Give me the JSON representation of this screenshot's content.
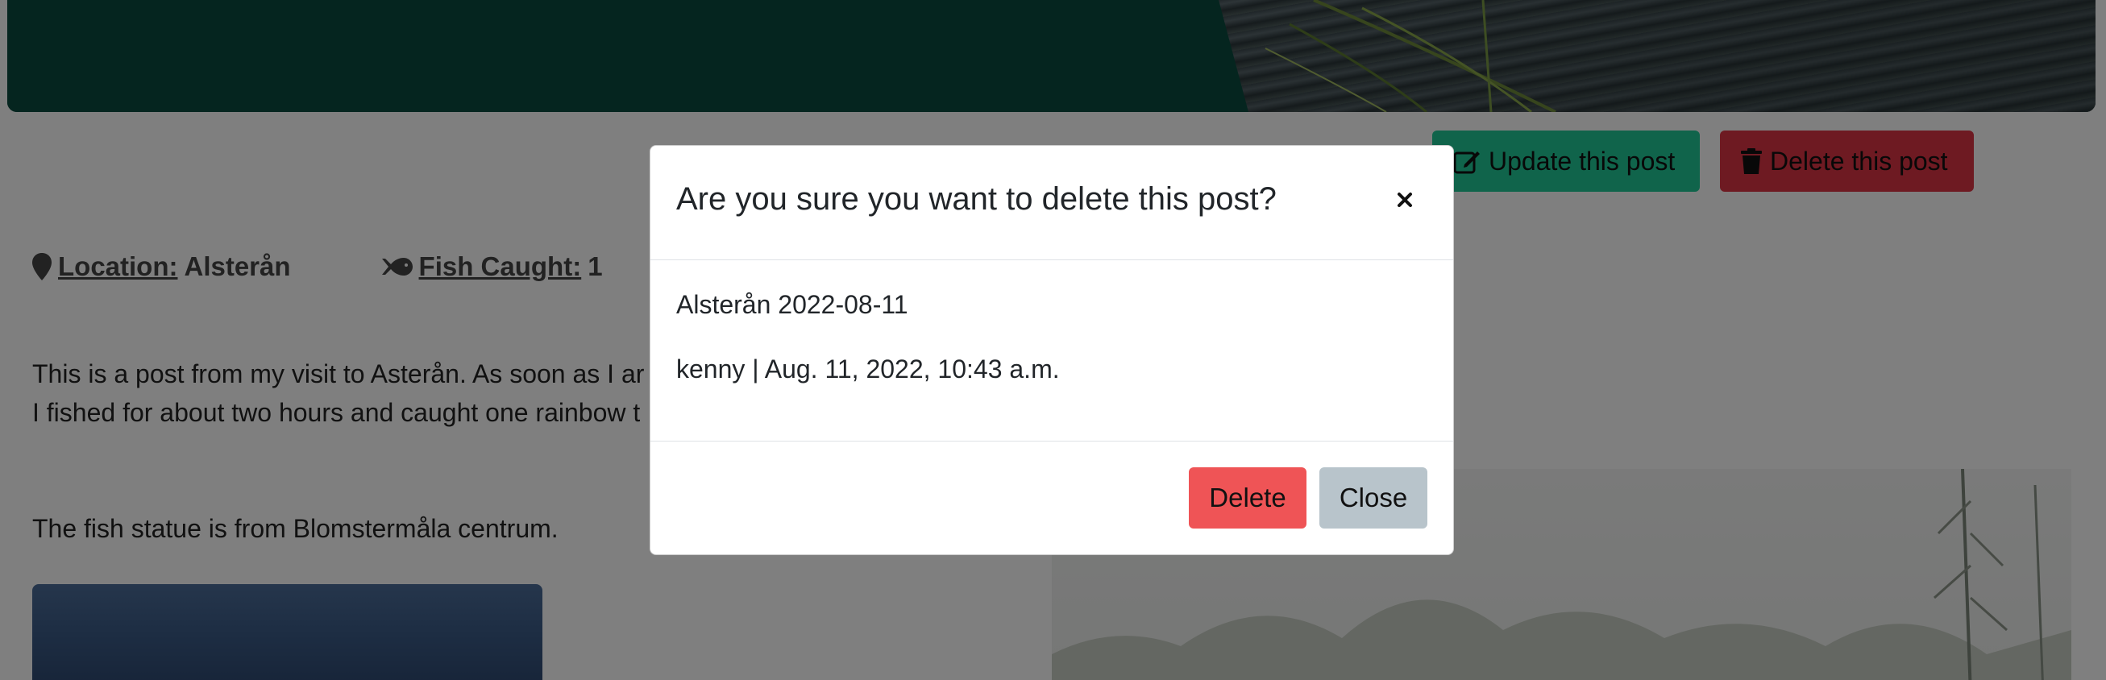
{
  "post": {
    "update_label": "Update this post",
    "delete_label": "Delete this post",
    "location_key": "Location:",
    "location_value": "Alsterån",
    "fish_key": "Fish Caught:",
    "fish_value": "1",
    "body_line1": "This is a post from my visit to Asterån. As soon as I ar",
    "body_line2": "I fished for about two hours and caught one rainbow t",
    "body_line3": "The fish statue is from Blomstermåla centrum."
  },
  "modal": {
    "title": "Are you sure you want to delete this post?",
    "post_title": "Alsterån 2022-08-11",
    "post_meta": "kenny | Aug. 11, 2022, 10:43 a.m.",
    "delete_label": "Delete",
    "close_label": "Close"
  },
  "icons": {
    "location": "map-marker-icon",
    "fish": "fish-icon",
    "edit": "edit-icon",
    "trash": "trash-icon",
    "close": "close-icon"
  },
  "colors": {
    "hero_green": "#0a4a3e",
    "update_button": "#20c997",
    "delete_button": "#dc3545",
    "modal_delete": "#ef5456",
    "modal_close": "#b8c4cb"
  }
}
